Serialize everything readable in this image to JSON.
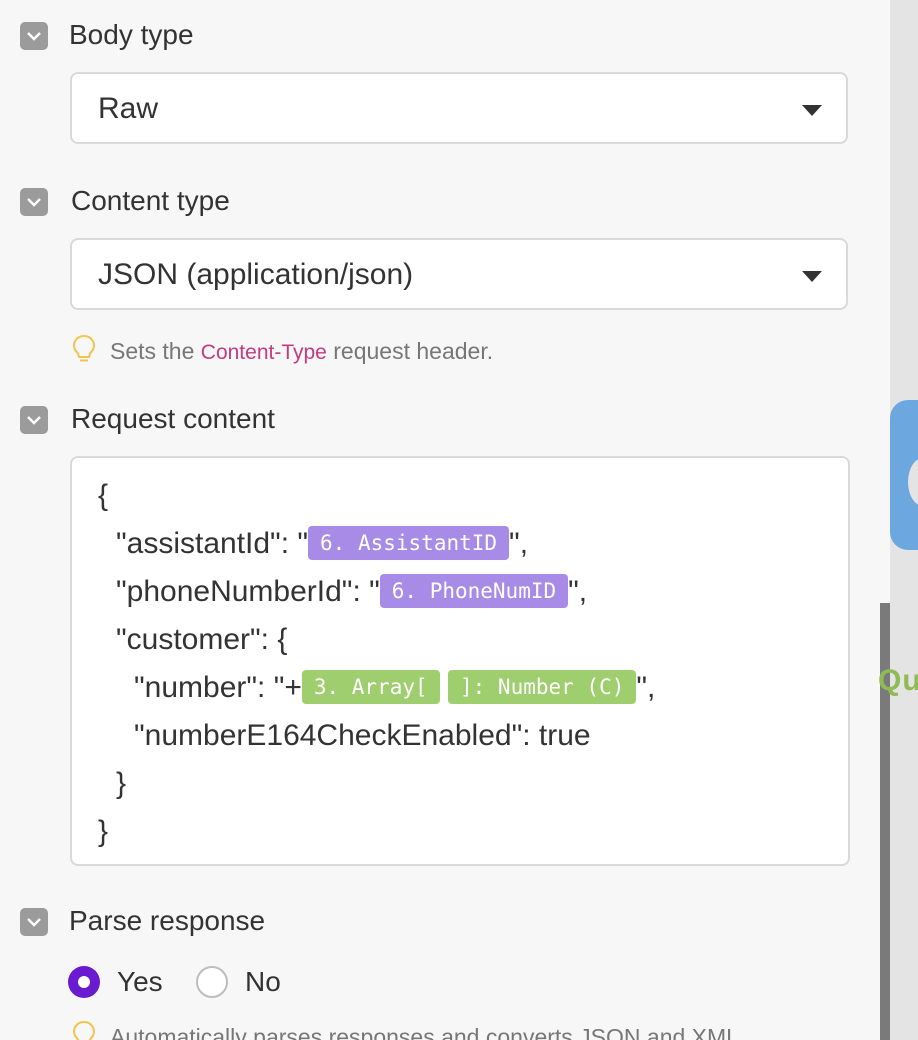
{
  "body_type": {
    "label": "Body type",
    "value": "Raw"
  },
  "content_type": {
    "label": "Content type",
    "value": "JSON (application/json)",
    "hint_prefix": "Sets the",
    "hint_code": "Content-Type",
    "hint_suffix": "request header."
  },
  "request_content": {
    "label": "Request content",
    "lines": {
      "l1": "{",
      "l2_pre": "\"assistantId\": \"",
      "l2_pill": "6. AssistantID",
      "l2_post": "\",",
      "l3_pre": "\"phoneNumberId\": \"",
      "l3_pill": "6. PhoneNumID",
      "l3_post": "\",",
      "l4": "\"customer\": {",
      "l5_pre": "\"number\": \"+",
      "l5_pill_a": "3. Array[",
      "l5_pill_b": "]: Number (C)",
      "l5_post": "\",",
      "l6": "\"numberE164CheckEnabled\": true",
      "l7": "}",
      "l8": "}"
    }
  },
  "parse_response": {
    "label": "Parse response",
    "options": [
      "Yes",
      "No"
    ],
    "selected": "Yes",
    "hint": "Automatically parses responses and converts JSON and XML"
  },
  "side_text": "Qu",
  "colors": {
    "accent_purple": "#6a1bd0",
    "pill_purple": "#a78be6",
    "pill_green": "#9fce6e",
    "code_pink": "#c43b7f"
  }
}
